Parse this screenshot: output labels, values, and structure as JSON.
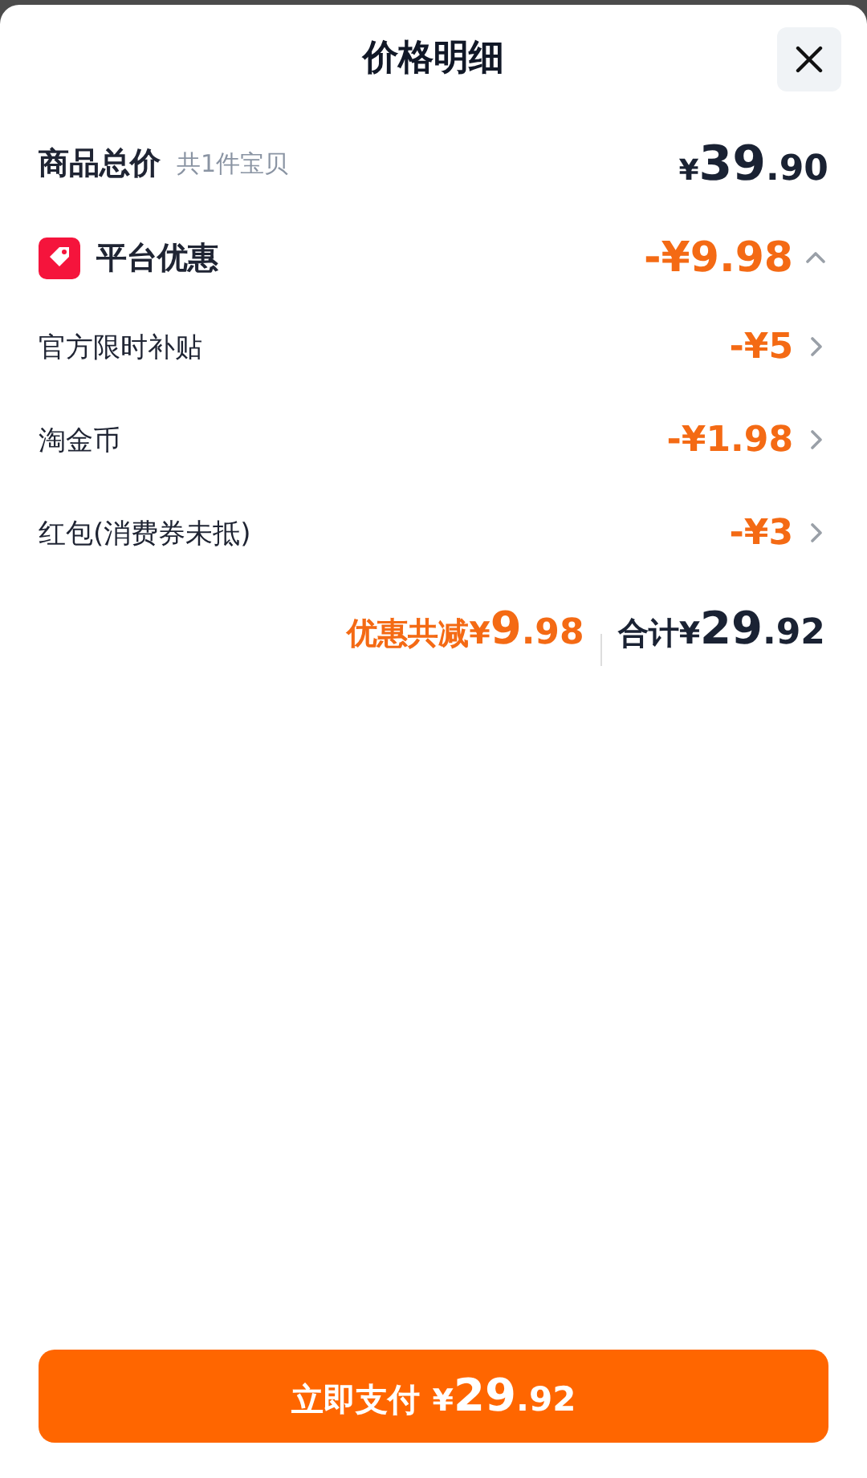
{
  "title": "价格明细",
  "total": {
    "label": "商品总价",
    "note": "共1件宝贝",
    "price": {
      "symbol": "¥",
      "integer": "39",
      "decimal": ".90"
    }
  },
  "platform_discount": {
    "label": "平台优惠",
    "amount": "-¥9.98",
    "expanded": true,
    "items": [
      {
        "label": "官方限时补贴",
        "amount": "-¥5"
      },
      {
        "label": "淘金币",
        "amount": "-¥1.98"
      },
      {
        "label": "红包(消费券未抵)",
        "amount": "-¥3"
      }
    ]
  },
  "summary": {
    "discount_label": "优惠共减",
    "discount": {
      "symbol": "¥",
      "integer": "9",
      "decimal": ".98"
    },
    "total_label": "合计",
    "total": {
      "symbol": "¥",
      "integer": "29",
      "decimal": ".92"
    }
  },
  "pay_button": {
    "label": "立即支付",
    "price": {
      "symbol": "¥",
      "integer": "29",
      "decimal": ".92"
    }
  }
}
